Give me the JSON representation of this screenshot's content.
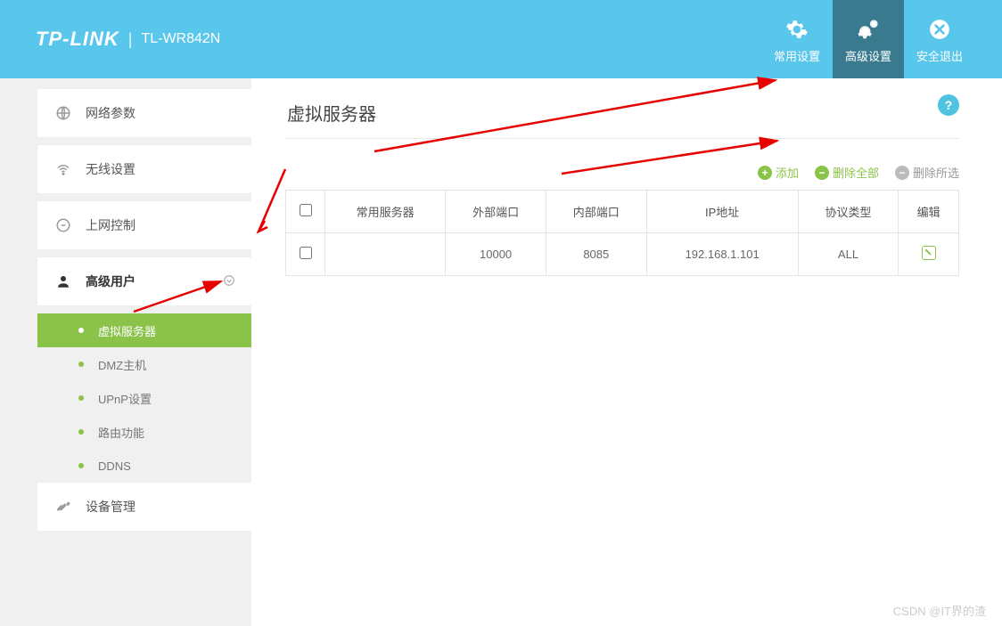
{
  "header": {
    "brand": "TP-LINK",
    "model": "TL-WR842N",
    "items": [
      {
        "label": "常用设置",
        "icon": "gear-icon",
        "active": false
      },
      {
        "label": "高级设置",
        "icon": "gears-icon",
        "active": true
      },
      {
        "label": "安全退出",
        "icon": "exit-icon",
        "active": false
      }
    ]
  },
  "sidebar": {
    "items": [
      {
        "label": "网络参数",
        "icon": "globe"
      },
      {
        "label": "无线设置",
        "icon": "wifi"
      },
      {
        "label": "上网控制",
        "icon": "control"
      },
      {
        "label": "高级用户",
        "icon": "user",
        "expanded": true,
        "children": [
          {
            "label": "虚拟服务器",
            "active": true
          },
          {
            "label": "DMZ主机"
          },
          {
            "label": "UPnP设置"
          },
          {
            "label": "路由功能"
          },
          {
            "label": "DDNS"
          }
        ]
      },
      {
        "label": "设备管理",
        "icon": "tools"
      }
    ]
  },
  "page": {
    "title": "虚拟服务器",
    "actions": {
      "add": "添加",
      "delete_all": "删除全部",
      "delete_selected": "删除所选"
    },
    "table": {
      "headers": [
        "",
        "常用服务器",
        "外部端口",
        "内部端口",
        "IP地址",
        "协议类型",
        "编辑"
      ],
      "rows": [
        {
          "checked": false,
          "server": "",
          "ext_port": "10000",
          "int_port": "8085",
          "ip": "192.168.1.101",
          "proto": "ALL"
        }
      ]
    }
  },
  "watermark": "CSDN @IT界的渣"
}
